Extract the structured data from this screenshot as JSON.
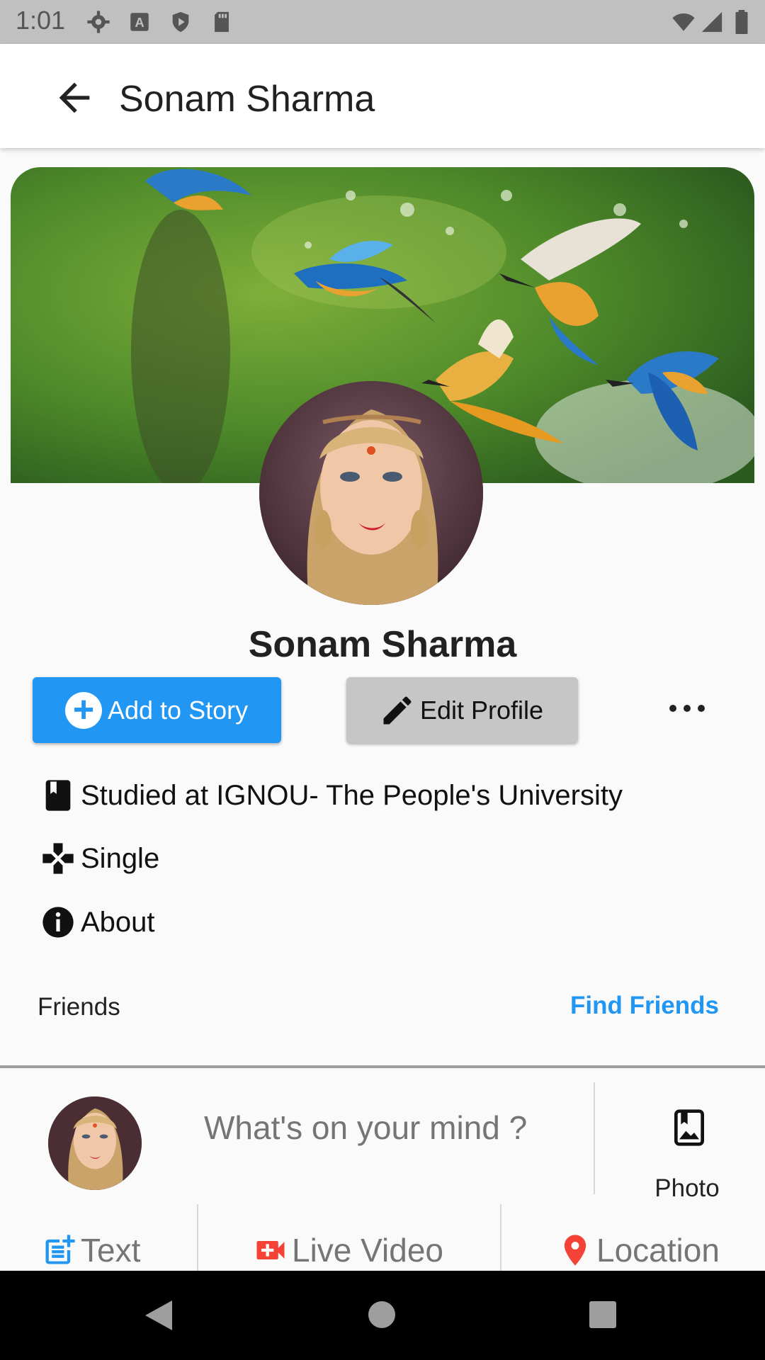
{
  "status_bar": {
    "time": "1:01"
  },
  "app_bar": {
    "title": "Sonam Sharma"
  },
  "profile": {
    "name": "Sonam Sharma",
    "add_story_label": "Add to Story",
    "edit_profile_label": "Edit Profile"
  },
  "info": {
    "studied": "Studied at IGNOU- The People's University",
    "relationship": "Single",
    "about": "About"
  },
  "friends": {
    "label": "Friends",
    "find_label": "Find Friends"
  },
  "composer": {
    "placeholder": "What's on your mind ?",
    "photo_label": "Photo"
  },
  "post_options": {
    "text": "Text",
    "live_video": "Live Video",
    "location": "Location"
  },
  "colors": {
    "primary": "#2196f3",
    "live_red": "#f44336",
    "location_red": "#f44336"
  }
}
